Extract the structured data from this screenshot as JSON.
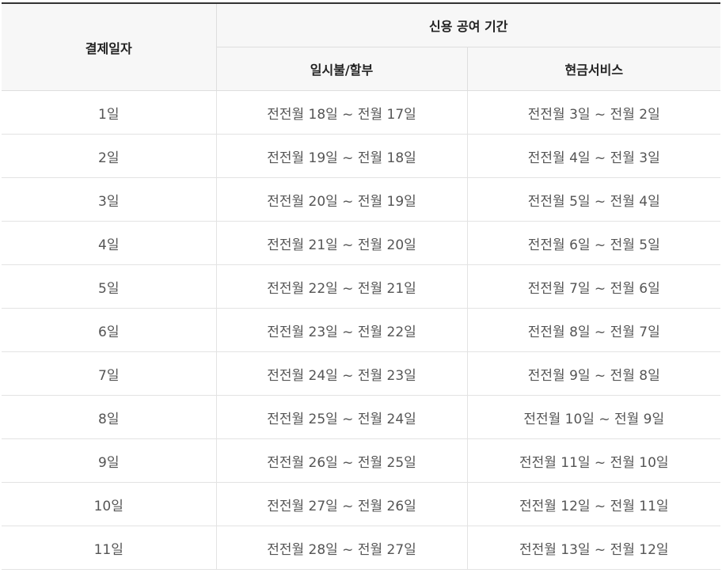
{
  "header": {
    "payment_date": "결제일자",
    "credit_period": "신용 공여 기간",
    "lump_installment": "일시불/할부",
    "cash_service": "현금서비스"
  },
  "rows": [
    {
      "day": "1일",
      "lump": "전전월 18일 ~ 전월 17일",
      "cash": "전전월 3일 ~ 전월 2일"
    },
    {
      "day": "2일",
      "lump": "전전월 19일 ~ 전월 18일",
      "cash": "전전월 4일 ~ 전월 3일"
    },
    {
      "day": "3일",
      "lump": "전전월 20일 ~ 전월 19일",
      "cash": "전전월 5일 ~ 전월 4일"
    },
    {
      "day": "4일",
      "lump": "전전월 21일 ~ 전월 20일",
      "cash": "전전월 6일 ~ 전월 5일"
    },
    {
      "day": "5일",
      "lump": "전전월 22일 ~ 전월 21일",
      "cash": "전전월 7일 ~ 전월 6일"
    },
    {
      "day": "6일",
      "lump": "전전월 23일 ~ 전월 22일",
      "cash": "전전월 8일 ~ 전월 7일"
    },
    {
      "day": "7일",
      "lump": "전전월 24일 ~ 전월 23일",
      "cash": "전전월 9일 ~ 전월 8일"
    },
    {
      "day": "8일",
      "lump": "전전월 25일 ~ 전월 24일",
      "cash": "전전월 10일 ~ 전월 9일"
    },
    {
      "day": "9일",
      "lump": "전전월 26일 ~ 전월 25일",
      "cash": "전전월 11일 ~ 전월 10일"
    },
    {
      "day": "10일",
      "lump": "전전월 27일 ~ 전월 26일",
      "cash": "전전월 12일 ~ 전월 11일"
    },
    {
      "day": "11일",
      "lump": "전전월 28일 ~ 전월 27일",
      "cash": "전전월 13일 ~ 전월 12일"
    }
  ]
}
